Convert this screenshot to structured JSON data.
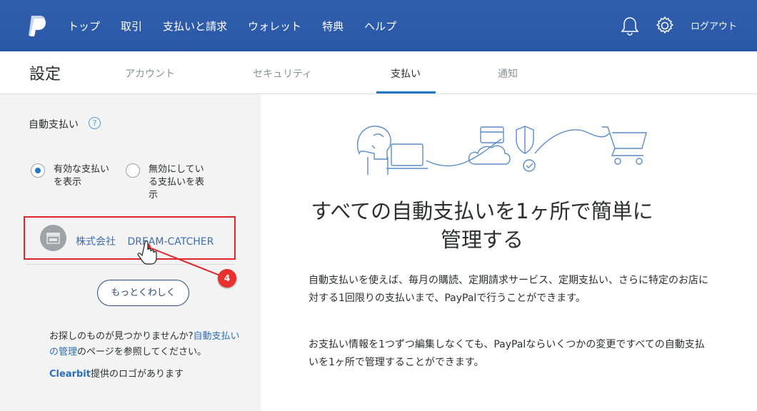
{
  "header": {
    "logo_icon": "paypal-logo-icon",
    "nav": [
      "トップ",
      "取引",
      "支払いと請求",
      "ウォレット",
      "特典",
      "ヘルプ"
    ],
    "logout": "ログアウト",
    "icons": [
      "bell-icon",
      "gear-icon"
    ],
    "color": "#2c5aa8"
  },
  "settings": {
    "title": "設定",
    "tabs": [
      "アカウント",
      "セキュリティ",
      "支払い",
      "通知"
    ],
    "active_tab": "支払い"
  },
  "left": {
    "autopay_label": "自動支払い",
    "help_glyph": "?",
    "radio_active_line1": "有効な支払い",
    "radio_active_line2": "を表示",
    "radio_inactive_line1": "無効にしてい",
    "radio_inactive_line2": "る支払いを表",
    "radio_inactive_line3": "示",
    "merchant_name": "株式会社 DREAM-CATCHER",
    "more_button": "もっとくわしく",
    "notfound_prefix": "お探しのものが見つかりませんか?",
    "notfound_link": "自動支払いの管理",
    "notfound_suffix": "のページを参照してください。",
    "clearbit_brand": "Clearbit",
    "clearbit_suffix": "提供のロゴがあります"
  },
  "annotation": {
    "badge": "4",
    "color": "#e0252b"
  },
  "right": {
    "headline": "すべての自動支払いを1ヶ所で簡単に管理する",
    "para1": "自動支払いを使えば、毎月の購読、定期請求サービス、定期支払い、さらに特定のお店に対する1回限りの支払いまで、PayPalで行うことができます。",
    "para2": "お支払い情報を1つずつ編集しなくても、PayPalならいくつかの変更ですべての自動支払いを1ヶ所で管理することができます。"
  }
}
